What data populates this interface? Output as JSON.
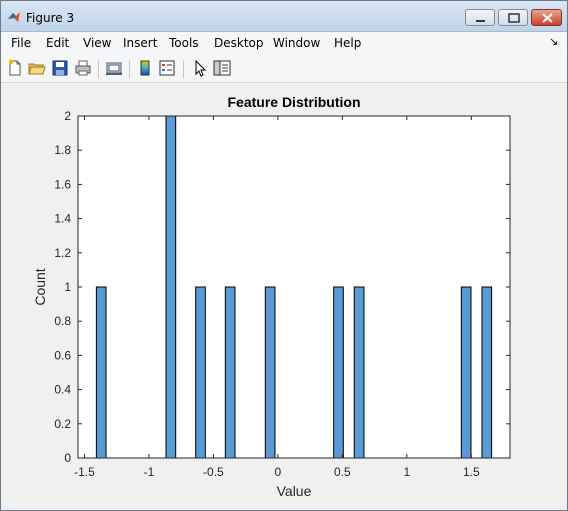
{
  "window": {
    "title": "Figure 3"
  },
  "menu": [
    "File",
    "Edit",
    "View",
    "Insert",
    "Tools",
    "Desktop",
    "Window",
    "Help"
  ],
  "toolbar_icons": [
    "new-figure-icon",
    "open-file-icon",
    "save-icon",
    "print-icon",
    "link-plot-icon",
    "insert-colorbar-icon",
    "insert-legend-icon",
    "edit-plot-pointer-icon",
    "property-inspector-icon"
  ],
  "colors": {
    "bar_fill": "#5b9bd5",
    "bar_edge": "#000000",
    "axes_bg": "#ffffff",
    "figure_bg": "#f0f0f0"
  },
  "chart_data": {
    "type": "bar",
    "title": "Feature Distribution",
    "xlabel": "Value",
    "ylabel": "Count",
    "xlim": [
      -1.55,
      1.8
    ],
    "ylim": [
      0,
      2
    ],
    "xticks": [
      "-1.5",
      "-1",
      "-0.5",
      "0",
      "0.5",
      "1",
      "1.5"
    ],
    "xtick_values": [
      -1.5,
      -1,
      -0.5,
      0,
      0.5,
      1,
      1.5
    ],
    "yticks": [
      "0",
      "0.2",
      "0.4",
      "0.6",
      "0.8",
      "1",
      "1.2",
      "1.4",
      "1.6",
      "1.8",
      "2"
    ],
    "ytick_values": [
      0,
      0.2,
      0.4,
      0.6,
      0.8,
      1,
      1.2,
      1.4,
      1.6,
      1.8,
      2
    ],
    "bin_width": 0.075,
    "bars": [
      {
        "x": -1.37,
        "count": 1
      },
      {
        "x": -0.83,
        "count": 2
      },
      {
        "x": -0.6,
        "count": 1
      },
      {
        "x": -0.37,
        "count": 1
      },
      {
        "x": -0.06,
        "count": 1
      },
      {
        "x": 0.47,
        "count": 1
      },
      {
        "x": 0.63,
        "count": 1
      },
      {
        "x": 1.46,
        "count": 1
      },
      {
        "x": 1.62,
        "count": 1
      }
    ],
    "grid": false,
    "legend": "none"
  }
}
